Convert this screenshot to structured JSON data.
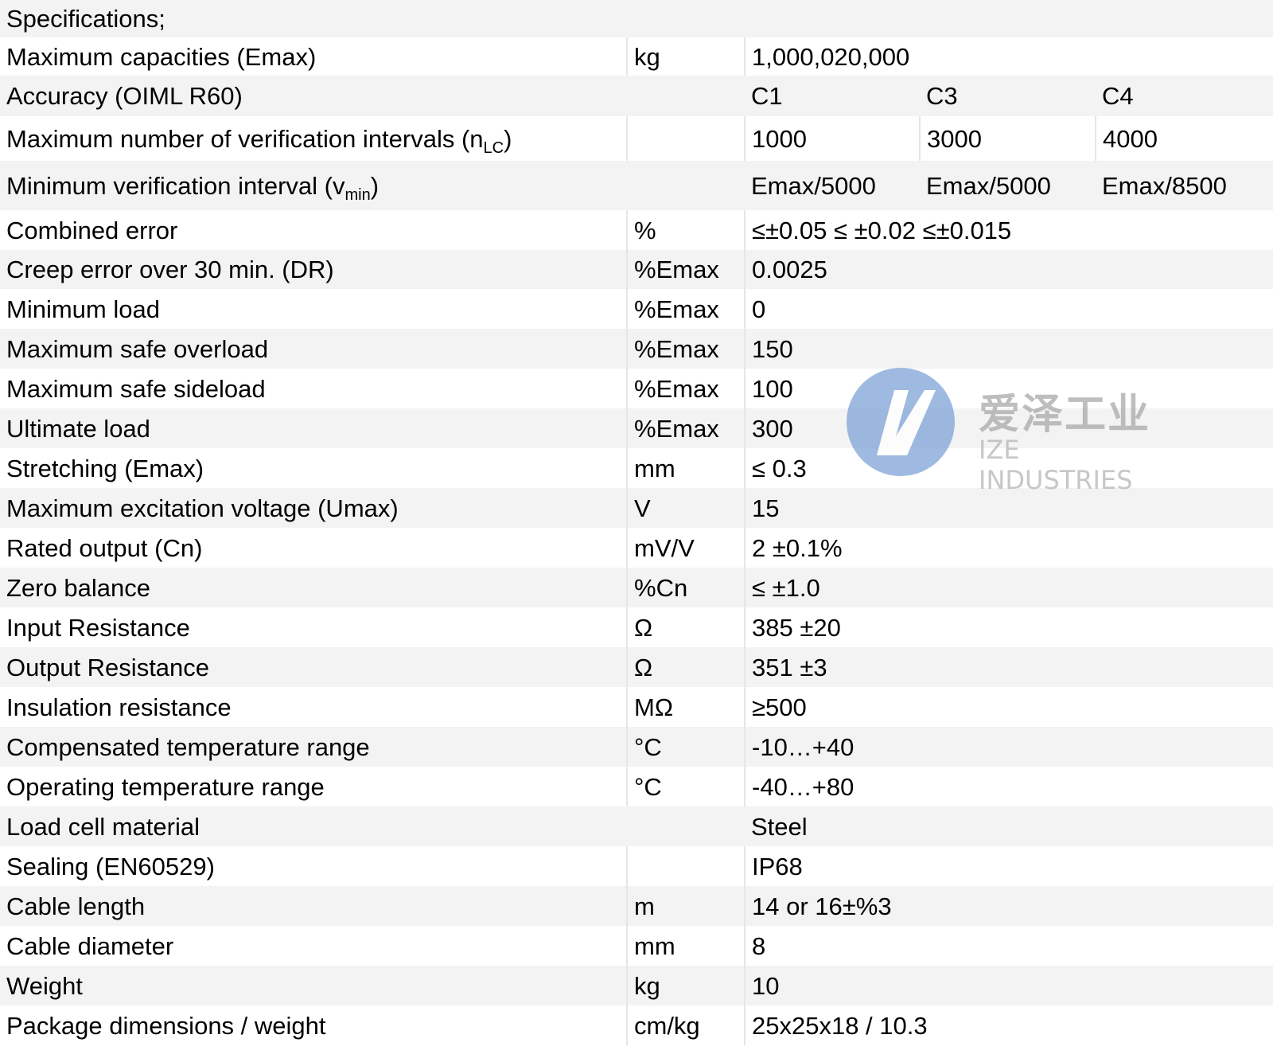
{
  "heading": "Specifications;",
  "rows": [
    {
      "label": "Maximum capacities (Emax)",
      "unit": "kg",
      "value": "1,000,020,000"
    },
    {
      "label": "Accuracy (OIML R60)",
      "unit": "",
      "cols": [
        "C1",
        "C3",
        "C4"
      ]
    },
    {
      "label": "Maximum number of verification intervals (n",
      "label_sub": "LC",
      "label_tail": ")",
      "unit": "",
      "cols": [
        "1000",
        "3000",
        "4000"
      ]
    },
    {
      "label": "Minimum verification interval (v",
      "label_sub": "min",
      "label_tail": ")",
      "unit": "",
      "cols": [
        "Emax/5000",
        "Emax/5000",
        "Emax/8500"
      ]
    },
    {
      "label": "Combined error",
      "unit": "%",
      "value": "≤±0.05 ≤ ±0.02 ≤±0.015"
    },
    {
      "label": "Creep error over 30 min. (DR)",
      "unit": "%Emax",
      "value": "0.0025"
    },
    {
      "label": "Minimum load",
      "unit": "%Emax",
      "value": "0"
    },
    {
      "label": "Maximum safe overload",
      "unit": "%Emax",
      "value": "150"
    },
    {
      "label": "Maximum safe sideload",
      "unit": "%Emax",
      "value": "100"
    },
    {
      "label": "Ultimate load",
      "unit": "%Emax",
      "value": "300"
    },
    {
      "label": "Stretching (Emax)",
      "unit": "mm",
      "value": "≤ 0.3"
    },
    {
      "label": "Maximum excitation voltage (Umax)",
      "unit": "V",
      "value": "15"
    },
    {
      "label": "Rated output (Cn)",
      "unit": "mV/V",
      "value": "2 ±0.1%"
    },
    {
      "label": "Zero balance",
      "unit": "%Cn",
      "value": "≤ ±1.0"
    },
    {
      "label": "Input Resistance",
      "unit": "Ω",
      "value": "385 ±20"
    },
    {
      "label": "Output Resistance",
      "unit": "Ω",
      "value": "351 ±3"
    },
    {
      "label": "Insulation resistance",
      "unit": "MΩ",
      "value": "≥500"
    },
    {
      "label": "Compensated temperature range",
      "unit": "°C",
      "value": "-10…+40"
    },
    {
      "label": "Operating temperature range",
      "unit": "°C",
      "value": "-40…+80"
    },
    {
      "label": "Load cell material",
      "unit": "",
      "value": "Steel"
    },
    {
      "label": "Sealing (EN60529)",
      "unit": "",
      "value": "IP68"
    },
    {
      "label": "Cable length",
      "unit": "m",
      "value": "14 or 16±%3"
    },
    {
      "label": "Cable diameter",
      "unit": "mm",
      "value": "8"
    },
    {
      "label": "Weight",
      "unit": "kg",
      "value": "10"
    },
    {
      "label": "Package dimensions / weight",
      "unit": "cm/kg",
      "value": "25x25x18 / 10.3"
    }
  ],
  "watermark": {
    "name_cn": "爱泽工业",
    "name_en": "IZE INDUSTRIES",
    "logo_icon": "ize-logo-icon",
    "color_logo": "#7fa3d8"
  }
}
